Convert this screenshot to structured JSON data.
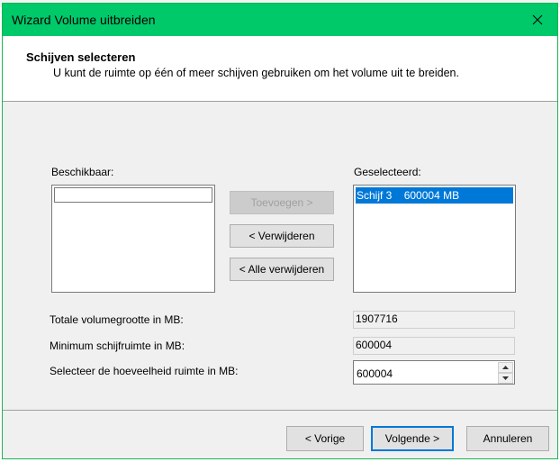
{
  "window": {
    "title": "Wizard Volume uitbreiden"
  },
  "header": {
    "title": "Schijven selecteren",
    "subtitle": "U kunt de ruimte op één of meer schijven gebruiken om het volume uit te breiden."
  },
  "available": {
    "label": "Beschikbaar:",
    "items": []
  },
  "selected": {
    "label": "Geselecteerd:",
    "items": [
      {
        "disk": "Schijf 3",
        "size": "600004 MB"
      }
    ]
  },
  "buttons": {
    "add": "Toevoegen >",
    "remove": "< Verwijderen",
    "remove_all": "< Alle verwijderen",
    "back": "< Vorige",
    "next": "Volgende >",
    "cancel": "Annuleren"
  },
  "fields": {
    "total_label": "Totale volumegrootte in MB:",
    "total_value": "1907716",
    "minimum_label": "Minimum schijfruimte in MB:",
    "minimum_value": "600004",
    "amount_label": "Selecteer de hoeveelheid ruimte in MB:",
    "amount_value": "600004"
  },
  "colors": {
    "titlebar": "#00c96a",
    "selection": "#0078d7"
  },
  "icons": {
    "close": "close-icon",
    "spin_up": "chevron-up-icon",
    "spin_down": "chevron-down-icon"
  }
}
